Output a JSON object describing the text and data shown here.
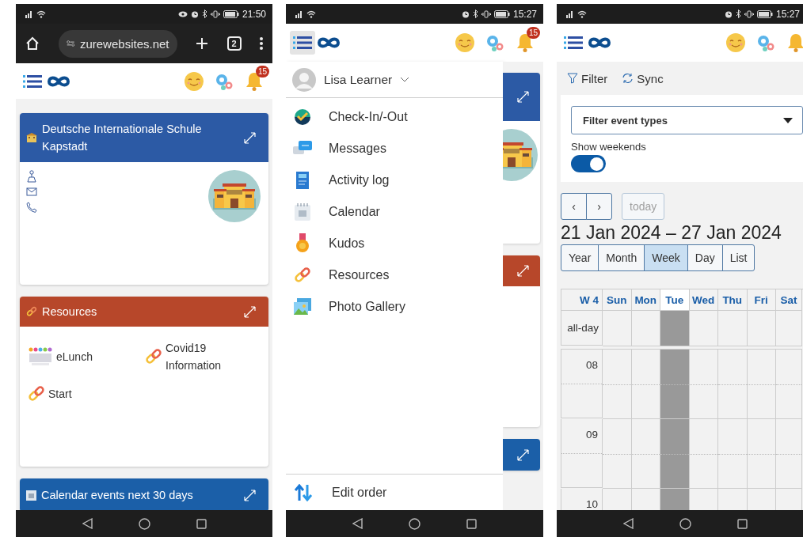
{
  "home_screen": {
    "status_bar": {
      "time": "21:50"
    },
    "browser_bar": {
      "url": "zurewebsites.net",
      "tab_count": "2"
    },
    "header": {
      "menu_open": false,
      "notification_count": "15"
    },
    "cards": [
      {
        "kind": "contact",
        "title": "Deutsche Internationale Schule Kapstadt",
        "color": "#2c5aa5"
      },
      {
        "kind": "links",
        "title": "Resources",
        "color": "#b7472a",
        "links": [
          {
            "kind": "logo",
            "label": "eLunch"
          },
          {
            "kind": "link",
            "label": "Covid19 Information"
          },
          {
            "kind": "link",
            "label": "Start"
          }
        ]
      },
      {
        "kind": "calendar",
        "title": "Calendar events next 30 days",
        "color": "#1b5fa8"
      }
    ]
  },
  "menu_screen": {
    "status_bar": {
      "time": "15:27"
    },
    "header": {
      "menu_open": true,
      "notification_count": "15"
    },
    "user": {
      "name": "Lisa Learner"
    },
    "items": [
      {
        "label": "Check-In/-Out"
      },
      {
        "label": "Messages"
      },
      {
        "label": "Activity log"
      },
      {
        "label": "Calendar"
      },
      {
        "label": "Kudos"
      },
      {
        "label": "Resources"
      },
      {
        "label": "Photo Gallery"
      }
    ],
    "footer_item": {
      "label": "Edit order"
    }
  },
  "calendar_screen": {
    "status_bar": {
      "time": "15:27"
    },
    "header": {
      "menu_open": false
    },
    "toolbar": [
      {
        "label": "Filter"
      },
      {
        "label": "Sync"
      }
    ],
    "filter_select": {
      "placeholder": "Filter event types"
    },
    "weekends_toggle": {
      "label": "Show weekends",
      "on": true
    },
    "nav_buttons": [
      {
        "label": "‹"
      },
      {
        "label": "›"
      }
    ],
    "today_button": {
      "label": "today",
      "disabled": true
    },
    "range_title": "21 Jan 2024 – 27 Jan 2024",
    "views": [
      {
        "label": "Year",
        "selected": false
      },
      {
        "label": "Month",
        "selected": false
      },
      {
        "label": "Week",
        "selected": true
      },
      {
        "label": "Day",
        "selected": false
      },
      {
        "label": "List",
        "selected": false
      }
    ],
    "week_label": "W 4",
    "days": [
      {
        "label": "Sun",
        "today": false
      },
      {
        "label": "Mon",
        "today": false
      },
      {
        "label": "Tue",
        "today": true
      },
      {
        "label": "Wed",
        "today": false
      },
      {
        "label": "Thu",
        "today": false
      },
      {
        "label": "Fri",
        "today": false
      },
      {
        "label": "Sat",
        "today": false
      }
    ],
    "all_day_label": "all-day",
    "hours": [
      "08",
      "09",
      "10"
    ]
  }
}
